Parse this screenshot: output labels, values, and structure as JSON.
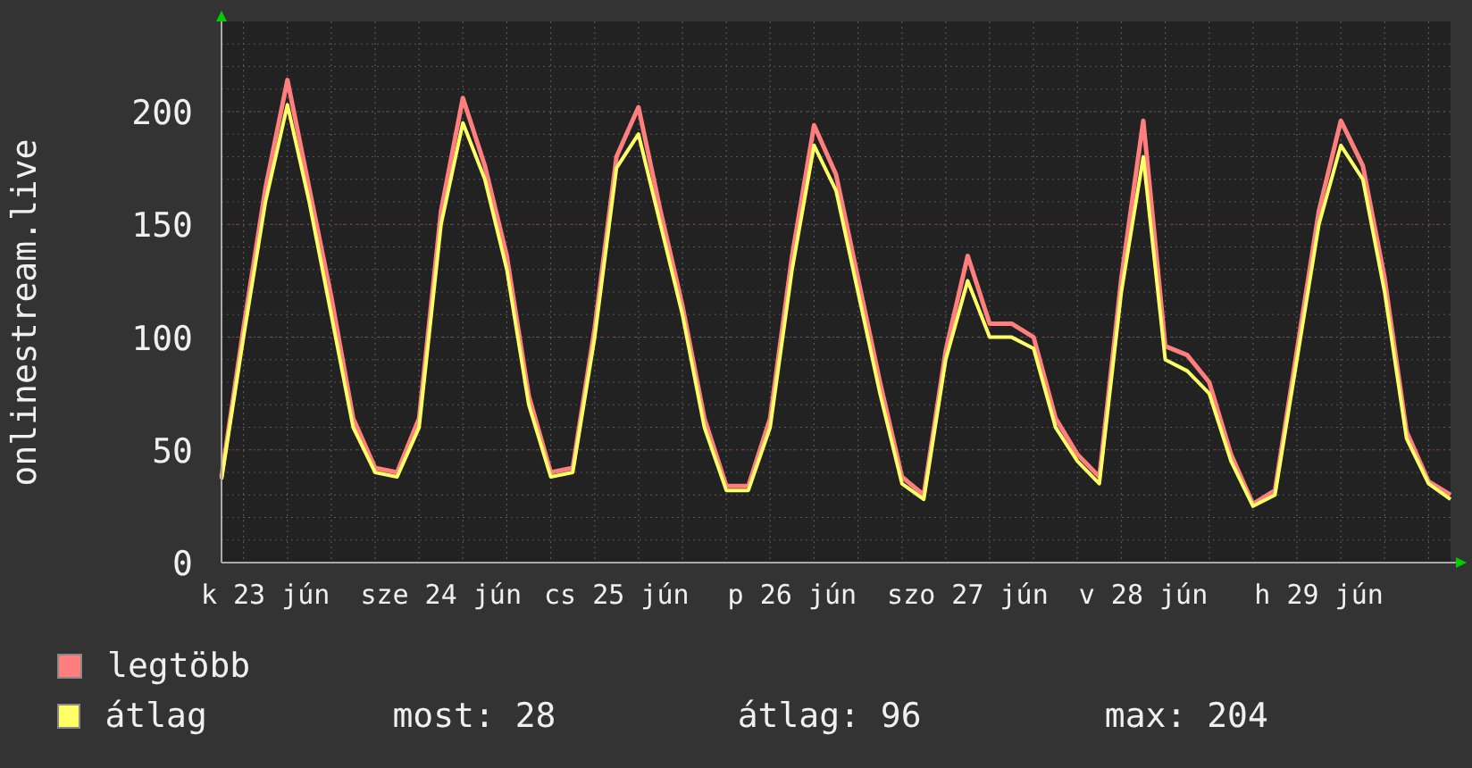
{
  "graph": {
    "chart_data": {
      "type": "line",
      "ylabel": "onlinestream.live",
      "ylim": [
        0,
        240
      ],
      "grid": true,
      "yticks": [
        0,
        50,
        100,
        150,
        200
      ],
      "categories": [
        null,
        null,
        "k 23 jún",
        null,
        null,
        null,
        null,
        null,
        null,
        null,
        "sze 24 jún",
        null,
        null,
        null,
        null,
        null,
        null,
        null,
        "cs 25 jún",
        null,
        null,
        null,
        null,
        null,
        null,
        null,
        "p 26 jún",
        null,
        null,
        null,
        null,
        null,
        null,
        null,
        "szo 27 jún",
        null,
        null,
        null,
        null,
        null,
        null,
        null,
        "v 28 jún",
        null,
        null,
        null,
        null,
        null,
        null,
        null,
        "h 29 jún",
        null,
        null,
        null,
        null,
        null,
        null
      ],
      "series": [
        {
          "name": "legtöbb",
          "color": "#ff7f7f",
          "values": [
            38,
            104,
            166,
            214,
            166,
            118,
            64,
            42,
            40,
            64,
            156,
            206,
            176,
            136,
            74,
            40,
            42,
            104,
            180,
            202,
            156,
            114,
            64,
            34,
            34,
            64,
            136,
            194,
            172,
            126,
            80,
            38,
            30,
            94,
            136,
            106,
            106,
            100,
            64,
            48,
            38,
            126,
            196,
            96,
            92,
            80,
            48,
            26,
            32,
            94,
            156,
            196,
            176,
            126,
            58,
            36,
            30
          ]
        },
        {
          "name": "átlag",
          "color": "#ffff66",
          "values": [
            37,
            100,
            160,
            203,
            160,
            110,
            60,
            40,
            38,
            60,
            150,
            195,
            170,
            130,
            70,
            38,
            40,
            100,
            175,
            190,
            150,
            110,
            60,
            32,
            32,
            60,
            130,
            185,
            165,
            120,
            75,
            35,
            28,
            90,
            125,
            100,
            100,
            95,
            60,
            45,
            35,
            120,
            180,
            90,
            85,
            75,
            45,
            25,
            30,
            90,
            150,
            185,
            170,
            120,
            55,
            35,
            28
          ]
        }
      ]
    }
  },
  "legend_stats": [
    "most: 28",
    "átlag: 96",
    "max: 204"
  ]
}
